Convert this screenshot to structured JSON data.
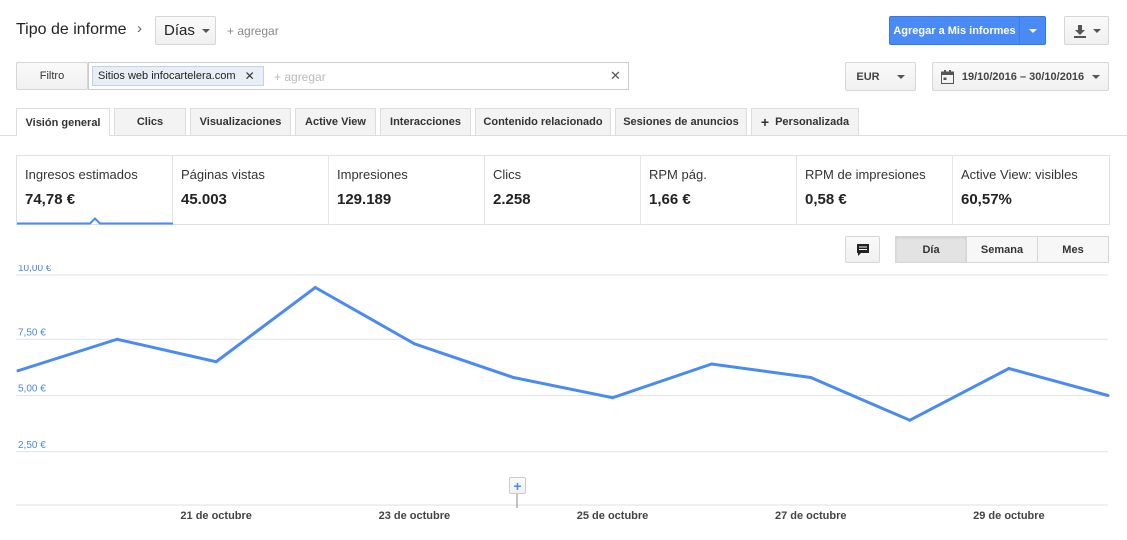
{
  "header": {
    "title": "Tipo de informe",
    "dimension_select": "Días",
    "add_link": "+ agregar",
    "save_button": "Agregar a Mis informes"
  },
  "filter_bar": {
    "filter_button": "Filtro",
    "chip_prefix": "Sitios web",
    "chip_value": "infocartelera.com",
    "add_placeholder": "+ agregar",
    "currency": "EUR",
    "date_range": "19/10/2016 – 30/10/2016"
  },
  "tabs": [
    {
      "label": "Visión general",
      "active": true
    },
    {
      "label": "Clics"
    },
    {
      "label": "Visualizaciones"
    },
    {
      "label": "Active View"
    },
    {
      "label": "Interacciones"
    },
    {
      "label": "Contenido relacionado"
    },
    {
      "label": "Sesiones de anuncios"
    },
    {
      "label": "Personalizada"
    }
  ],
  "metrics": [
    {
      "label": "Ingresos estimados",
      "value": "74,78 €",
      "selected": true
    },
    {
      "label": "Páginas vistas",
      "value": "45.003"
    },
    {
      "label": "Impresiones",
      "value": "129.189"
    },
    {
      "label": "Clics",
      "value": "2.258"
    },
    {
      "label": "RPM pág.",
      "value": "1,66 €"
    },
    {
      "label": "RPM de impresiones",
      "value": "0,58 €"
    },
    {
      "label": "Active View: visibles",
      "value": "60,57%"
    }
  ],
  "granularity": {
    "day": "Día",
    "week": "Semana",
    "month": "Mes",
    "selected": "Día"
  },
  "colors": {
    "accent": "#4a8af4",
    "line": "#4a8af4",
    "axis_text": "#4a86e8"
  },
  "icons": {
    "comment": "comment-icon",
    "calendar": "calendar-icon",
    "download": "download-icon",
    "add_annotation": "plus-icon"
  },
  "chart_data": {
    "type": "line",
    "x": [
      "19/10",
      "20/10",
      "21/10",
      "22/10",
      "23/10",
      "24/10",
      "25/10",
      "26/10",
      "27/10",
      "28/10",
      "29/10",
      "30/10"
    ],
    "xtick_labels": [
      "21 de octubre",
      "23 de octubre",
      "25 de octubre",
      "27 de octubre",
      "29 de octubre"
    ],
    "xtick_index": [
      2,
      4,
      6,
      8,
      10
    ],
    "series": [
      {
        "values": [
          6.1,
          7.5,
          6.5,
          9.8,
          7.3,
          5.8,
          4.9,
          6.4,
          5.8,
          3.9,
          6.2,
          5.0
        ]
      }
    ],
    "yticks": [
      "10,00 €",
      "7,50 €",
      "5,00 €",
      "2,50 €"
    ],
    "ytick_values": [
      10,
      7.5,
      5,
      2.5
    ],
    "ylim": [
      0,
      10
    ],
    "grid": true
  }
}
